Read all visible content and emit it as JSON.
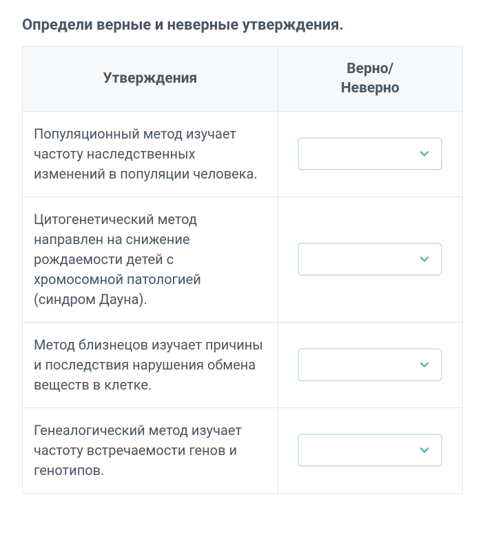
{
  "title": "Определи верные и неверные утверждения.",
  "headers": {
    "statements": "Утверждения",
    "answer": "Верно/\nНеверно"
  },
  "rows": [
    {
      "statement": "Популяционный метод изучает частоту наследственных изменений в популяции человека.",
      "selected": ""
    },
    {
      "statement": "Цитогенетический метод направлен на снижение рождаемости детей с хромосомной патологией (синдром Дауна).",
      "selected": ""
    },
    {
      "statement": "Метод близнецов изучает причины и последствия нарушения обмена веществ в клетке.",
      "selected": ""
    },
    {
      "statement": "Генеалогический метод изучает частоту встречаемости генов и генотипов.",
      "selected": ""
    }
  ]
}
